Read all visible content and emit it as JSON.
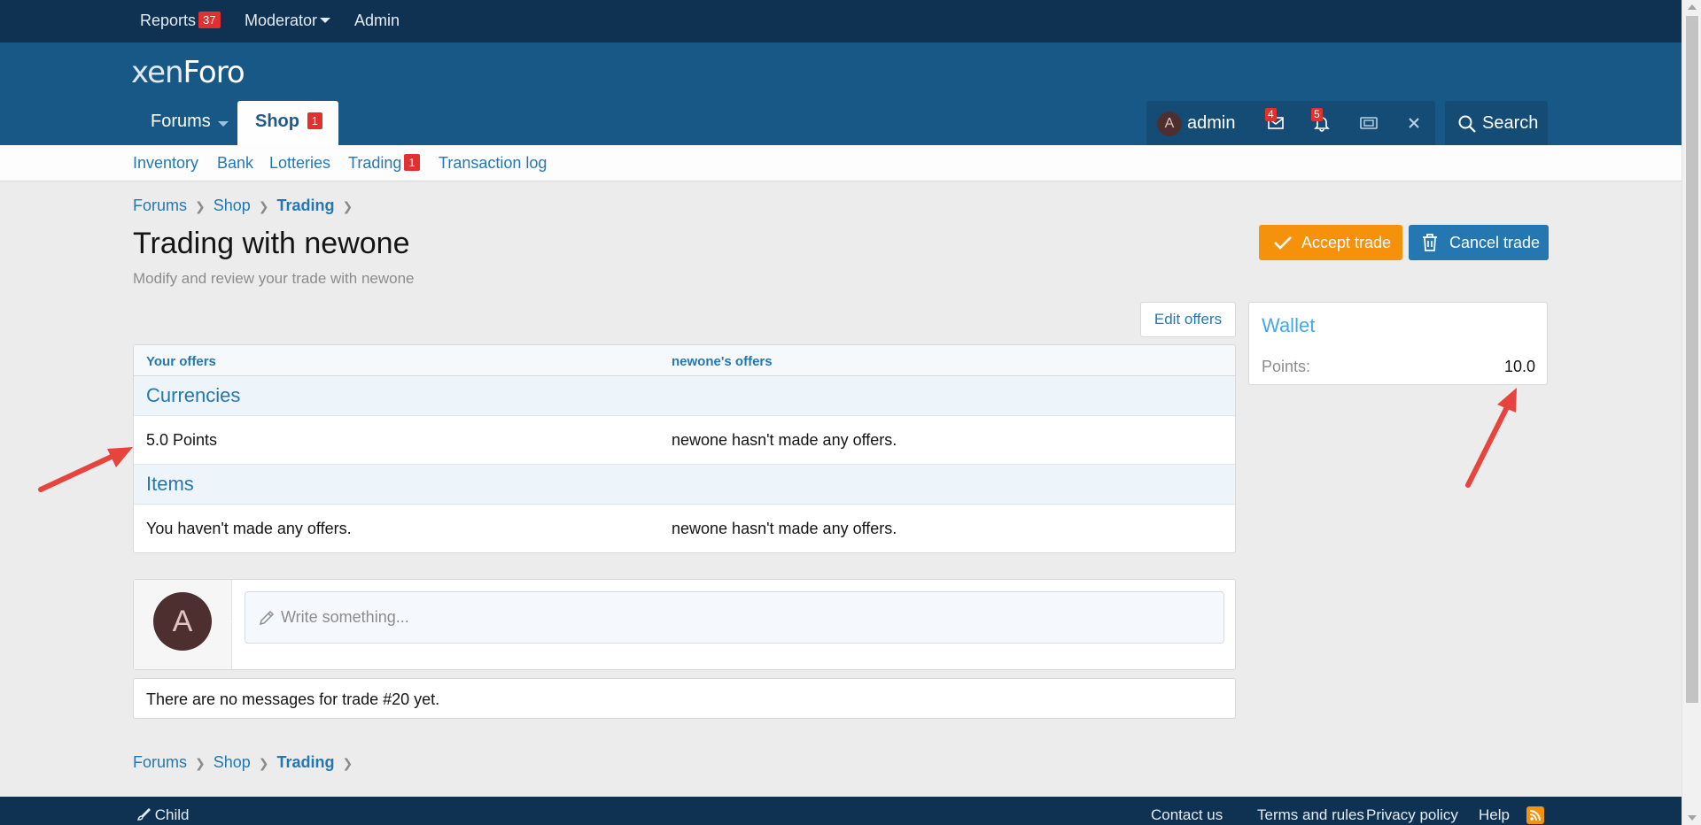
{
  "staffbar": {
    "reports_label": "Reports",
    "reports_count": "37",
    "moderator_label": "Moderator",
    "admin_label": "Admin"
  },
  "header": {
    "logo_text_a": "xen",
    "logo_text_b": "Foro",
    "tabs": [
      {
        "label": "Forums"
      },
      {
        "label": "Shop",
        "badge": "1"
      }
    ],
    "user": {
      "avatar_letter": "A",
      "name": "admin",
      "conversations_count": "4",
      "alerts_count": "5"
    },
    "search_label": "Search"
  },
  "subnav": {
    "items": [
      {
        "label": "Inventory"
      },
      {
        "label": "Bank"
      },
      {
        "label": "Lotteries"
      },
      {
        "label": "Trading",
        "badge": "1"
      },
      {
        "label": "Transaction log"
      }
    ]
  },
  "breadcrumb": {
    "items": [
      "Forums",
      "Shop",
      "Trading"
    ]
  },
  "page": {
    "title": "Trading with newone",
    "description": "Modify and review your trade with newone",
    "accept_label": "Accept trade",
    "cancel_label": "Cancel trade",
    "edit_offers_label": "Edit offers"
  },
  "offers": {
    "your_offers_header": "Your offers",
    "their_offers_header": "newone's offers",
    "sections": [
      {
        "title": "Currencies",
        "your_value": "5.0 Points",
        "their_value": "newone hasn't made any offers."
      },
      {
        "title": "Items",
        "your_value": "You haven't made any offers.",
        "their_value": "newone hasn't made any offers."
      }
    ]
  },
  "wallet": {
    "title": "Wallet",
    "points_label": "Points:",
    "points_value": "10.0"
  },
  "messages": {
    "avatar_letter": "A",
    "placeholder": "Write something...",
    "empty_text": "There are no messages for trade #20 yet."
  },
  "footer": {
    "style_label": "Child",
    "links": [
      "Contact us",
      "Terms and rules",
      "Privacy policy",
      "Help"
    ]
  },
  "colors": {
    "staffbar": "#0f3252",
    "header": "#185886",
    "link": "#2577b1",
    "accept": "#f5910b",
    "annotation_arrow": "#e8443e"
  }
}
